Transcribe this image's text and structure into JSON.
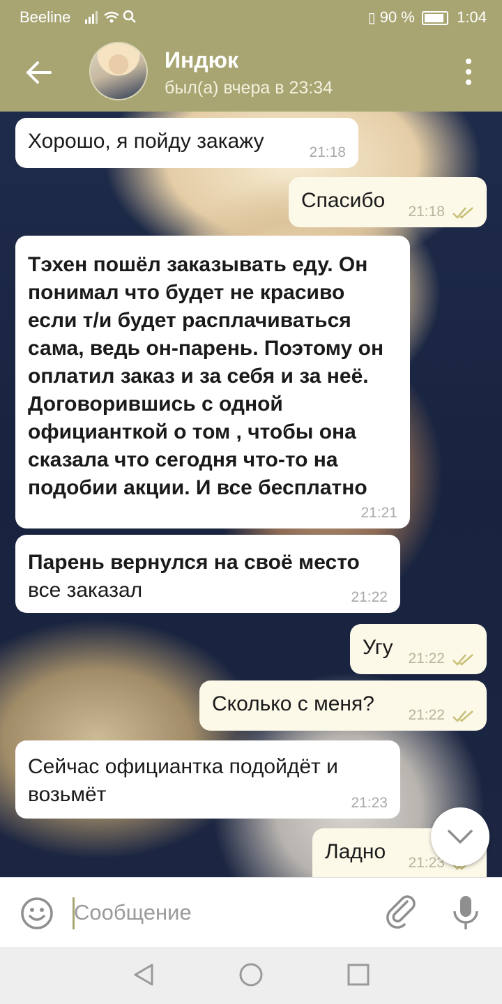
{
  "status_bar": {
    "carrier": "Beeline",
    "battery": "90 %",
    "time": "1:04"
  },
  "header": {
    "name": "Индюк",
    "last_seen": "был(а) вчера в 23:34"
  },
  "messages": [
    {
      "direction": "in",
      "text": "Хорошо, я пойду закажу",
      "time": "21:18"
    },
    {
      "direction": "out",
      "text": "Спасибо",
      "time": "21:18",
      "read": true
    },
    {
      "direction": "in",
      "bold": true,
      "text": "Тэхен пошёл заказывать еду. Он понимал что будет не красиво если т/и будет расплачиваться сама, ведь он-парень. Поэтому он оплатил заказ и за себя и за неё. Договорившись с одной официанткой о том , чтобы она сказала что сегодня что-то на подобии акции. И все бесплатно",
      "time": "21:21"
    },
    {
      "direction": "in",
      "text_bold": "Парень вернулся на своё место",
      "text_rest": "все заказал",
      "time": "21:22"
    },
    {
      "direction": "out",
      "text": "Угу",
      "time": "21:22",
      "read": true
    },
    {
      "direction": "out",
      "text": "Сколько с меня?",
      "time": "21:22",
      "read": true
    },
    {
      "direction": "in",
      "text": "Сейчас официантка подойдёт и возьмёт",
      "time": "21:23"
    },
    {
      "direction": "out",
      "text": "Ладно",
      "time": "21:23",
      "read": true
    }
  ],
  "input": {
    "placeholder": "Сообщение"
  },
  "colors": {
    "accent": "#a8a573",
    "bubble_out": "#fcf9e9",
    "bubble_in": "#ffffff"
  }
}
